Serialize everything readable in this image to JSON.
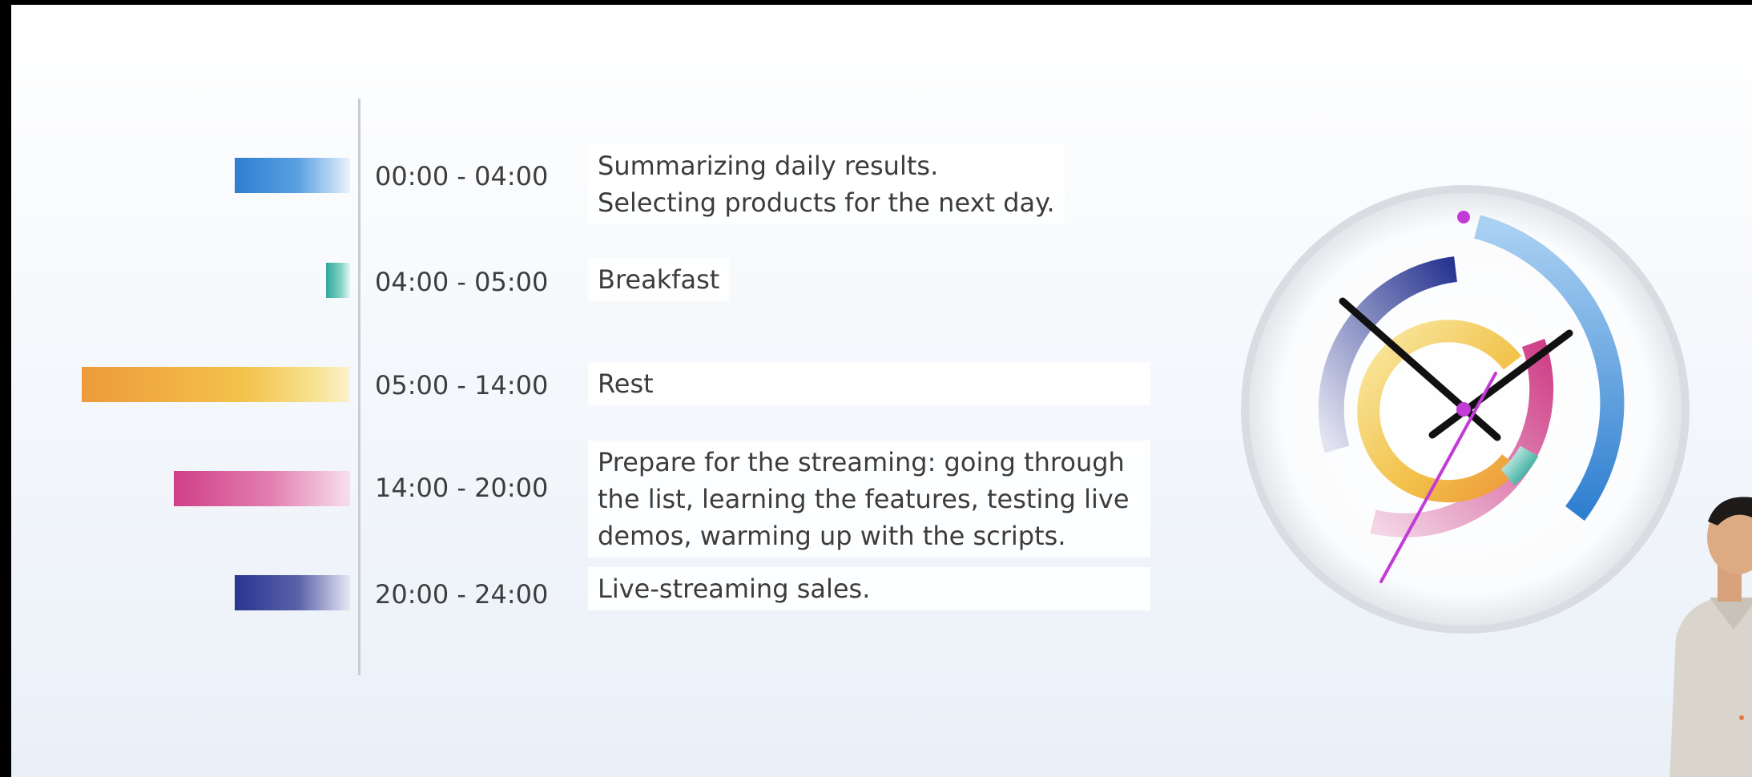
{
  "schedule": [
    {
      "time": "00:00 - 04:00",
      "lines": [
        "Summarizing daily results.",
        "Selecting products for the next day."
      ],
      "color": "#2f7fd0",
      "duration_hours": 4
    },
    {
      "time": "04:00 - 05:00",
      "lines": [
        "Breakfast"
      ],
      "color": "#2ea89a",
      "duration_hours": 1
    },
    {
      "time": "05:00 - 14:00",
      "lines": [
        "Rest"
      ],
      "color": "#ef9f3a",
      "duration_hours": 9
    },
    {
      "time": "14:00 - 20:00",
      "lines": [
        "Prepare for the streaming: going through",
        "the list, learning the features, testing live",
        "demos, warming up with the scripts."
      ],
      "color": "#d0418a",
      "duration_hours": 6
    },
    {
      "time": "20:00 - 24:00",
      "lines": [
        "Live-streaming sales."
      ],
      "color": "#2a3590",
      "duration_hours": 4
    }
  ],
  "clock": {
    "icon": "clock-icon",
    "ring_colors": [
      "#2f7fd0",
      "#2ea89a",
      "#f0b63a",
      "#d0418a",
      "#2a3590"
    ],
    "hand_color": "#111111",
    "second_hand_color": "#c23bd6"
  },
  "presenter": {
    "icon": "presenter-avatar"
  }
}
